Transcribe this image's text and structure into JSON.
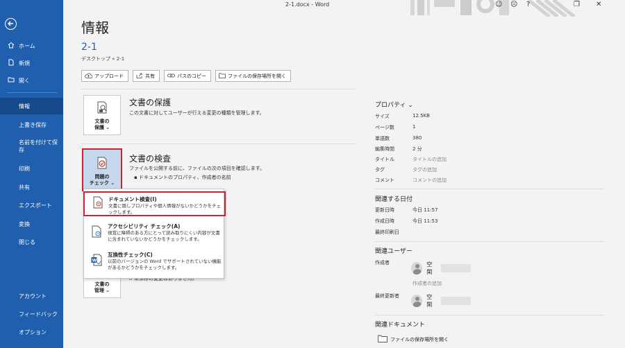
{
  "window": {
    "title": "2-1.docx - Word"
  },
  "nav": {
    "home": "ホーム",
    "new": "新規",
    "open": "開く",
    "info": "情報",
    "save": "上書き保存",
    "save_as_1": "名前を付けて保",
    "save_as_2": "存",
    "print": "印刷",
    "share": "共有",
    "export": "エクスポート",
    "transform": "変換",
    "close": "閉じる",
    "account": "アカウント",
    "feedback": "フィードバック",
    "options": "オプション"
  },
  "main": {
    "heading": "情報",
    "doc_name": "2-1",
    "doc_path": "デスクトップ » 2-1",
    "toolbar": {
      "upload": "アップロード",
      "share": "共有",
      "copy_path": "パスのコピー",
      "open_location": "ファイルの保存場所を開く"
    },
    "protect": {
      "btn_1": "文書の",
      "btn_2": "保護 ⌄",
      "title": "文書の保護",
      "desc": "この文書に対してユーザーが行える変更の種類を管理します。"
    },
    "inspect": {
      "btn_1": "問題の",
      "btn_2": "チェック ⌄",
      "title": "文書の検査",
      "desc": "ファイルを公開する前に、ファイルの次の項目を確認します。",
      "bullet": "ドキュメントのプロパティ、作成者の名前"
    },
    "manage": {
      "btn_1": "文書の",
      "btn_2": "管理 ⌄",
      "desc_partial": "未保存の変更はありません。"
    }
  },
  "menu": {
    "items": [
      {
        "title": "ドキュメント検査(I)",
        "desc": "文書に隠しプロパティや個人情報がないかどうかをチェックします。"
      },
      {
        "title": "アクセシビリティ チェック(A)",
        "desc": "視覚に障碍のある方にとって読み取りにくい内容が文書に含まれていないかどうかをチェックします。"
      },
      {
        "title": "互換性チェック(C)",
        "desc": "以前のバージョンの Word でサポートされていない機能があるかどうかをチェックします。"
      }
    ]
  },
  "properties": {
    "title": "プロパティ ⌄",
    "rows": [
      {
        "label": "サイズ",
        "value": "12.5KB"
      },
      {
        "label": "ページ数",
        "value": "1"
      },
      {
        "label": "単語数",
        "value": "380"
      },
      {
        "label": "編集時間",
        "value": "2 分"
      },
      {
        "label": "タイトル",
        "value": "タイトルの追加"
      },
      {
        "label": "タグ",
        "value": "タグの追加"
      },
      {
        "label": "コメント",
        "value": "コメントの追加"
      }
    ],
    "dates_title": "関連する日付",
    "dates": [
      {
        "label": "更新日時",
        "value": "今日 11:57"
      },
      {
        "label": "作成日時",
        "value": "今日 11:53"
      },
      {
        "label": "最終印刷日",
        "value": ""
      }
    ],
    "users_title": "関連ユーザー",
    "author_label": "作成者",
    "author_name": "空閑",
    "add_author": "作成者の追加",
    "last_modified_label": "最終更新者",
    "last_modified_name": "空閑",
    "docs_title": "関連ドキュメント",
    "open_location": "ファイルの保存場所を開く"
  }
}
